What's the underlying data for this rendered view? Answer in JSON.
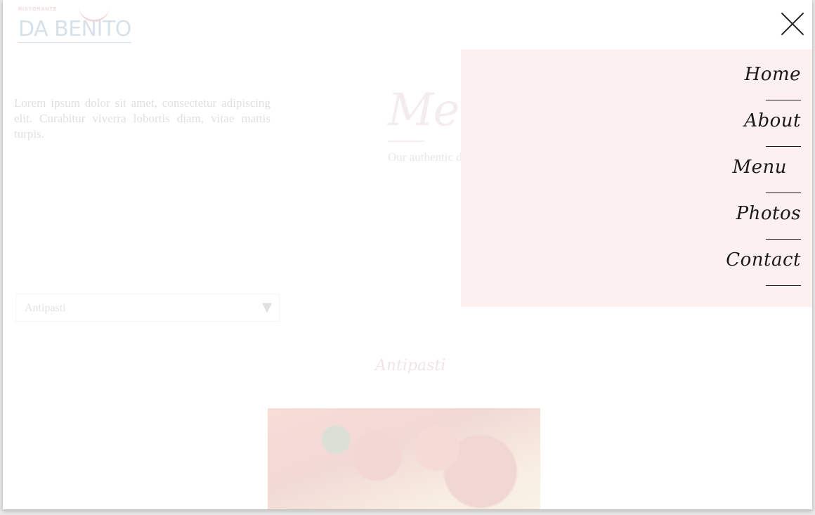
{
  "logo": {
    "small_text": "RISTORANTE",
    "name": "DA BENITO"
  },
  "intro": {
    "text": "Lorem ipsum dolor sit amet, consectetur adipiscing elit. Curabitur viverra lobortis diam, vitae mattis turpis."
  },
  "menu_section": {
    "heading": "Menu",
    "subtitle": "Our authentic dishes"
  },
  "category_select": {
    "value": "Antipasti",
    "arrow_icon": "triangle-down-icon"
  },
  "section_title": "Antipasti",
  "close_icon": "close-icon",
  "nav": {
    "background": "#fcf0f1",
    "items": [
      {
        "label": "Home"
      },
      {
        "label": "About"
      },
      {
        "label": "Menu"
      },
      {
        "label": "Photos"
      },
      {
        "label": "Contact"
      }
    ]
  }
}
